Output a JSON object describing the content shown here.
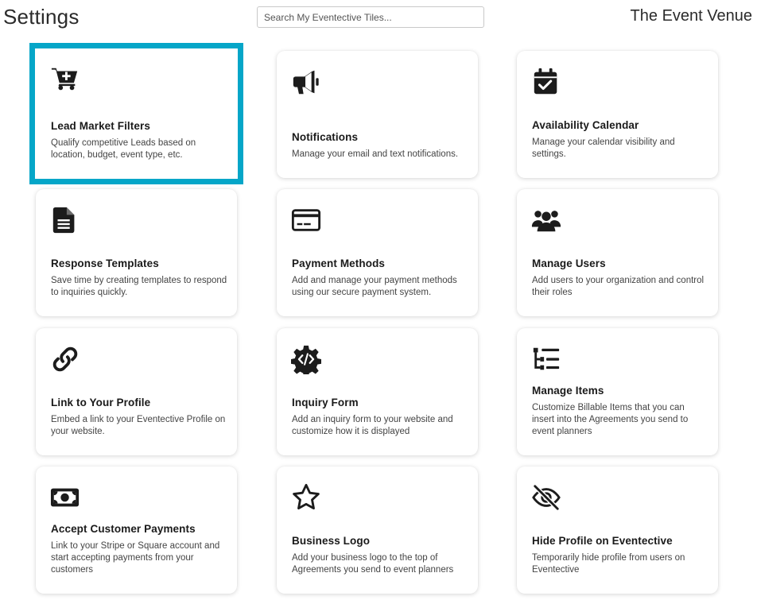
{
  "header": {
    "title": "Settings",
    "search_placeholder": "Search My Eventective Tiles...",
    "venue_name": "The Event Venue"
  },
  "tiles": [
    {
      "title": "Lead Market Filters",
      "desc": "Qualify competitive Leads based on location, budget, event type, etc.",
      "icon": "cart-plus-icon",
      "highlighted": true
    },
    {
      "title": "Notifications",
      "desc": "Manage your email and text notifications.",
      "icon": "megaphone-icon"
    },
    {
      "title": "Availability Calendar",
      "desc": "Manage your calendar visibility and settings.",
      "icon": "calendar-check-icon"
    },
    {
      "title": "Response Templates",
      "desc": "Save time by creating templates to respond to inquiries quickly.",
      "icon": "document-icon"
    },
    {
      "title": "Payment Methods",
      "desc": "Add and manage your payment methods using our secure payment system.",
      "icon": "credit-card-icon"
    },
    {
      "title": "Manage Users",
      "desc": "Add users to your organization and control their roles",
      "icon": "users-icon"
    },
    {
      "title": "Link to Your Profile",
      "desc": "Embed a link to your Eventective Profile on your website.",
      "icon": "link-icon"
    },
    {
      "title": "Inquiry Form",
      "desc": "Add an inquiry form to your website and customize how it is displayed",
      "icon": "code-gear-icon"
    },
    {
      "title": "Manage Items",
      "desc": "Customize Billable Items that you can insert into the Agreements you send to event planners",
      "icon": "list-tree-icon"
    },
    {
      "title": "Accept Customer Payments",
      "desc": "Link to your Stripe or Square account and start accepting payments from your customers",
      "icon": "money-bill-icon"
    },
    {
      "title": "Business Logo",
      "desc": "Add your business logo to the top of Agreements you send to event planners",
      "icon": "star-icon"
    },
    {
      "title": "Hide Profile on Eventective",
      "desc": "Temporarily hide profile from users on Eventective",
      "icon": "eye-slash-icon"
    }
  ],
  "colors": {
    "highlight_border": "#05a6c8",
    "icon": "#1c1c1c"
  }
}
